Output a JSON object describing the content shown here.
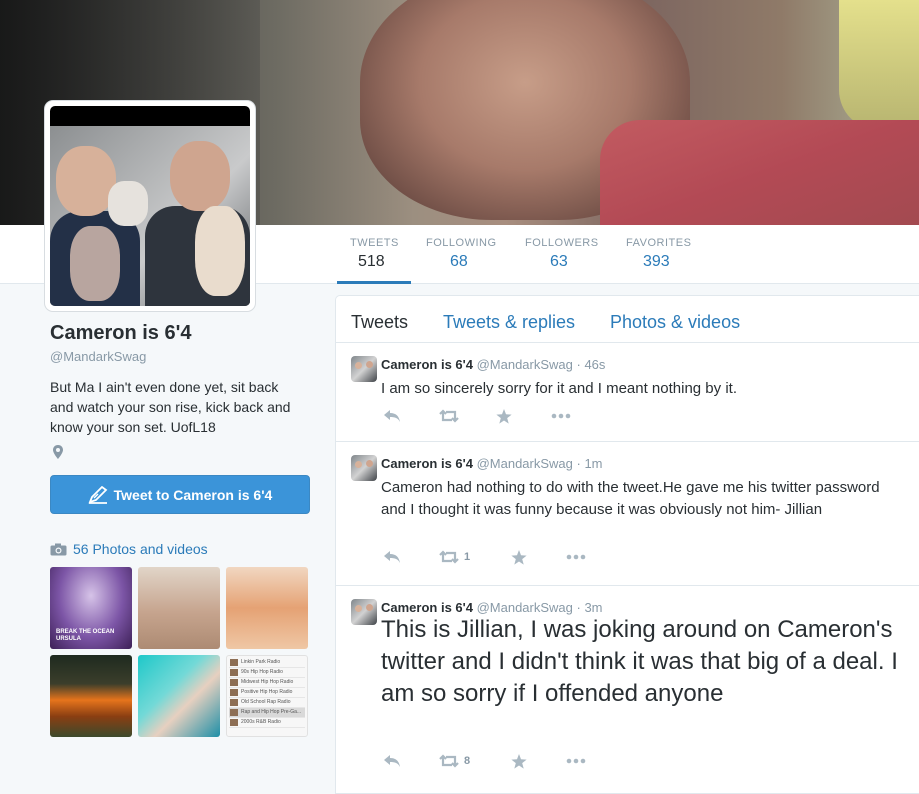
{
  "profile": {
    "name": "Cameron is 6'4",
    "handle": "@MandarkSwag",
    "bio": "But Ma I ain't even done yet, sit back and watch your son rise, kick back and know your son set. UofL18",
    "tweet_to_label": "Tweet to Cameron is 6'4",
    "media_label": "56 Photos and videos"
  },
  "stats": [
    {
      "label": "TWEETS",
      "value": "518"
    },
    {
      "label": "FOLLOWING",
      "value": "68"
    },
    {
      "label": "FOLLOWERS",
      "value": "63"
    },
    {
      "label": "FAVORITES",
      "value": "393"
    }
  ],
  "tabs": [
    "Tweets",
    "Tweets & replies",
    "Photos & videos"
  ],
  "thumbs": {
    "t1_caption": "BREAK THE OCEAN URSULA",
    "radio_list": [
      "Linkin Park Radio",
      "90s Hip Hop Radio",
      "Midwest Hip Hop Radio",
      "Positive Hip Hop Radio",
      "Old School Rap Radio",
      "Rap and Hip Hop Pre-Ga...",
      "2000s R&B Radio"
    ]
  },
  "tweets": [
    {
      "name": "Cameron is 6'4",
      "handle": "@MandarkSwag",
      "time": "· 46s",
      "text": "I am so sincerely sorry for it and I meant nothing by it.",
      "retweets": ""
    },
    {
      "name": "Cameron is 6'4",
      "handle": "@MandarkSwag",
      "time": "· 1m",
      "text": "Cameron had nothing to do with the tweet.He gave me his twitter password and I thought it was funny because it was obviously not him- Jillian",
      "retweets": "1"
    },
    {
      "name": "Cameron is 6'4",
      "handle": "@MandarkSwag",
      "time": "· 3m",
      "text": "This is Jillian, I was joking around on Cameron's twitter and I didn't think it was that big of a deal. I am so sorry if I offended anyone",
      "retweets": "8"
    }
  ],
  "colors": {
    "link_blue": "#2b7bb9",
    "button_blue": "#3b94d9",
    "muted": "#8899a6",
    "text": "#292f33"
  }
}
